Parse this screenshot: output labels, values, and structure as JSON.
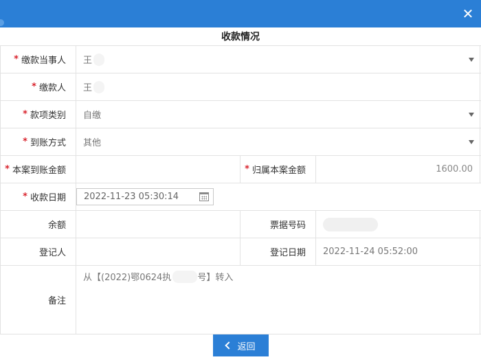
{
  "window": {
    "close_glyph": "✕"
  },
  "form": {
    "title": "收款情况",
    "fields": {
      "payer_party": {
        "label": "缴款当事人",
        "value": "王",
        "required": true,
        "control": "select"
      },
      "payer": {
        "label": "缴款人",
        "value": "王",
        "required": true
      },
      "payment_type": {
        "label": "款项类别",
        "value": "自缴",
        "required": true,
        "control": "select"
      },
      "arrival_method": {
        "label": "到账方式",
        "value": "其他",
        "required": true,
        "control": "select"
      },
      "case_arrival_amount": {
        "label": "本案到账金额",
        "value": "",
        "required": true
      },
      "case_attributed_amount": {
        "label": "归属本案金额",
        "value": "1600.00",
        "required": true
      },
      "receipt_date": {
        "label": "收款日期",
        "value": "2022-11-23 05:30:14",
        "required": true,
        "icon": "calendar-icon"
      },
      "balance": {
        "label": "余额",
        "value": ""
      },
      "ticket_no": {
        "label": "票据号码",
        "value": ""
      },
      "registrar": {
        "label": "登记人",
        "value": ""
      },
      "register_date": {
        "label": "登记日期",
        "value": "2022-11-24 05:52:00"
      },
      "remark": {
        "label": "备注",
        "value_prefix": "从【(2022)鄂0624执",
        "value_suffix": "号】转入"
      }
    }
  },
  "actions": {
    "back_label": "返回",
    "back_icon": "chevron-left-icon"
  },
  "colors": {
    "accent": "#2b7fd6",
    "required": "#d9232d"
  }
}
